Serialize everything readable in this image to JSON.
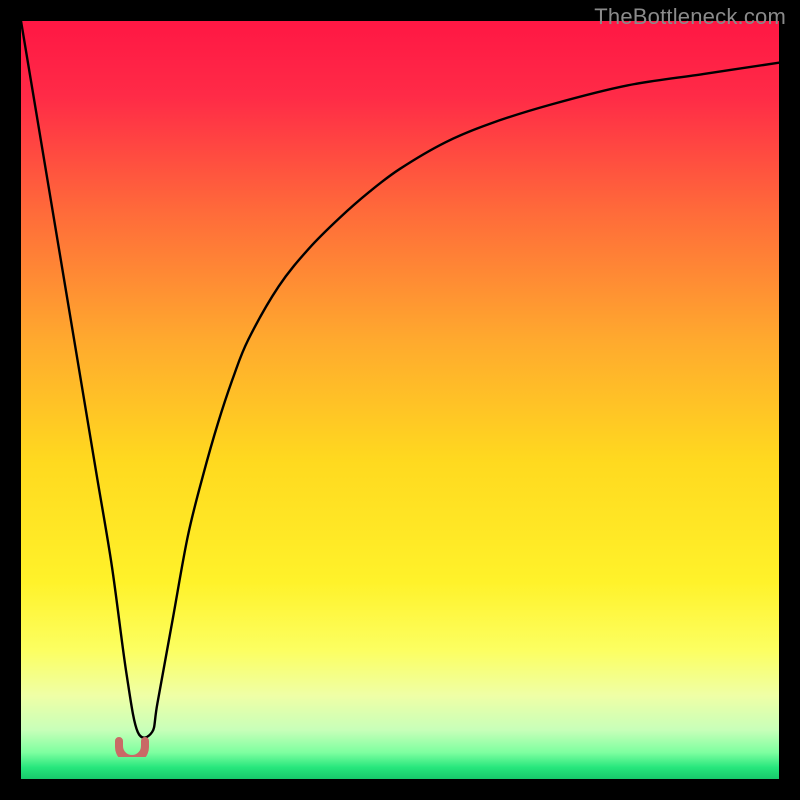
{
  "watermark": "TheBottleneck.com",
  "chart_data": {
    "type": "line",
    "title": "",
    "xlabel": "",
    "ylabel": "",
    "xlim": [
      0,
      100
    ],
    "ylim": [
      0,
      100
    ],
    "grid": false,
    "series": [
      {
        "name": "bottleneck-curve",
        "x": [
          0,
          2,
          4,
          6,
          8,
          10,
          12,
          13.9,
          15.4,
          17.3,
          18,
          20,
          22,
          24,
          26,
          28,
          30,
          34,
          38,
          42,
          46,
          50,
          56,
          62,
          70,
          80,
          90,
          100
        ],
        "values": [
          100,
          88,
          76,
          64,
          52,
          40,
          28,
          14,
          6.2,
          6.2,
          10,
          21,
          32,
          40,
          47,
          53,
          58,
          65,
          70,
          74,
          77.5,
          80.5,
          84,
          86.5,
          89,
          91.5,
          93,
          94.5
        ]
      }
    ],
    "annotations": [
      {
        "name": "optimal-marker",
        "x": 14.6,
        "y": 4.5,
        "shape": "u"
      }
    ],
    "background_gradient": {
      "type": "vertical",
      "stops": [
        {
          "pos": 0.0,
          "color": "#ff1744"
        },
        {
          "pos": 0.1,
          "color": "#ff2b47"
        },
        {
          "pos": 0.25,
          "color": "#ff6a3a"
        },
        {
          "pos": 0.42,
          "color": "#ffa92e"
        },
        {
          "pos": 0.58,
          "color": "#ffd91f"
        },
        {
          "pos": 0.74,
          "color": "#fff22a"
        },
        {
          "pos": 0.83,
          "color": "#fcff61"
        },
        {
          "pos": 0.89,
          "color": "#efffa6"
        },
        {
          "pos": 0.935,
          "color": "#c8ffb9"
        },
        {
          "pos": 0.965,
          "color": "#7effa0"
        },
        {
          "pos": 0.985,
          "color": "#26e67c"
        },
        {
          "pos": 1.0,
          "color": "#17c96b"
        }
      ]
    }
  }
}
